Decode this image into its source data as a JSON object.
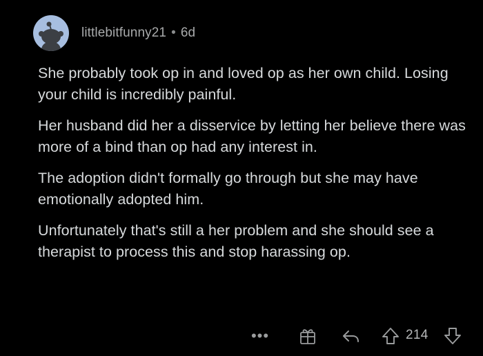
{
  "comment": {
    "username": "littlebitfunny21",
    "separator": "•",
    "age": "6d",
    "paragraphs": [
      "She probably took op in and loved op as her own child.  Losing your child is incredibly painful.",
      "Her husband did her a disservice by letting her believe there was more of a bind than op had any interest in.",
      "The adoption didn't formally go through but she may have emotionally adopted him.",
      "Unfortunately that's still a her problem and she should see a therapist to process this and stop harassing op."
    ],
    "actions": {
      "more_label": "•••",
      "upvote_count": "214",
      "icons": [
        "more-icon",
        "award-icon",
        "reply-icon",
        "upvote-icon",
        "downvote-icon"
      ]
    }
  },
  "colors": {
    "background": "#000000",
    "text": "#d7dadc",
    "meta": "#a8aaab",
    "avatar_bg": "#a7bee0",
    "icon": "#9a9c9d"
  }
}
